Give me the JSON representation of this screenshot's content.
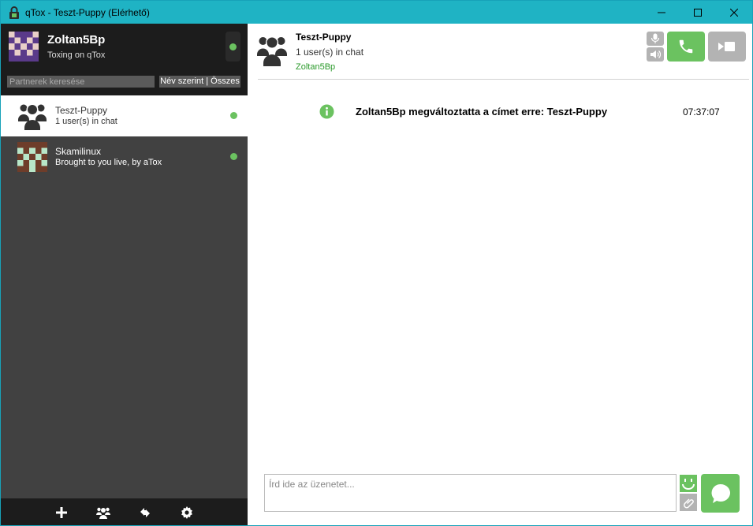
{
  "window": {
    "title": "qTox - Teszt-Puppy (Elérhető)",
    "accent_color": "#1fb3c4"
  },
  "profile": {
    "name": "Zoltan5Bp",
    "status_message": "Toxing on qTox",
    "status": "online"
  },
  "search": {
    "placeholder": "Partnerek keresése",
    "sort_label": "Név szerint | Összes"
  },
  "contacts": [
    {
      "name": "Teszt-Puppy",
      "status": "1 user(s) in chat",
      "icon": "group-avatar-icon",
      "active": true
    },
    {
      "name": "Skamilinux",
      "status": "Brought to you live, by aTox",
      "icon": "identicon-avatar",
      "active": false
    }
  ],
  "bottombar": {
    "icons": [
      "add-friend-icon",
      "create-group-icon",
      "file-transfers-icon",
      "settings-icon"
    ]
  },
  "chat": {
    "title": "Teszt-Puppy",
    "user_count": "1 user(s) in chat",
    "members": "Zoltan5Bp",
    "messages": [
      {
        "icon": "info-icon",
        "text": "Zoltan5Bp megváltoztatta a címet erre: Teszt-Puppy",
        "time": "07:37:07"
      }
    ],
    "input_placeholder": "Írd ide az üzenetet..."
  },
  "colors": {
    "online": "#6bc260",
    "sidebar_bg": "#414141",
    "sidebar_dark": "#1c1c1c",
    "button_grey": "#b3b3b3"
  }
}
